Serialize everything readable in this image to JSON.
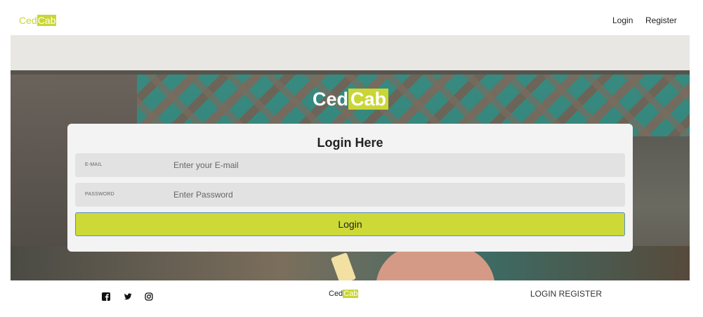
{
  "header": {
    "logo_part1": "Ced",
    "logo_part2": "Cab",
    "nav_login": "Login",
    "nav_register": "Register"
  },
  "hero": {
    "title_part1": "Ced",
    "title_part2": "Cab"
  },
  "login_form": {
    "title": "Login Here",
    "email_label": "E-MAIL",
    "email_placeholder": "Enter your E-mail",
    "password_label": "PASSWORD",
    "password_placeholder": "Enter Password",
    "submit_label": "Login"
  },
  "footer": {
    "social_icons": [
      "facebook-icon",
      "twitter-icon",
      "instagram-icon"
    ],
    "logo_part1": "Ced",
    "logo_part2": "Cab",
    "links": "LOGIN REGISTER"
  },
  "colors": {
    "brand": "#c9d636",
    "button": "#ccd937",
    "card": "#f3f3f3",
    "field": "#e2e2e2"
  }
}
